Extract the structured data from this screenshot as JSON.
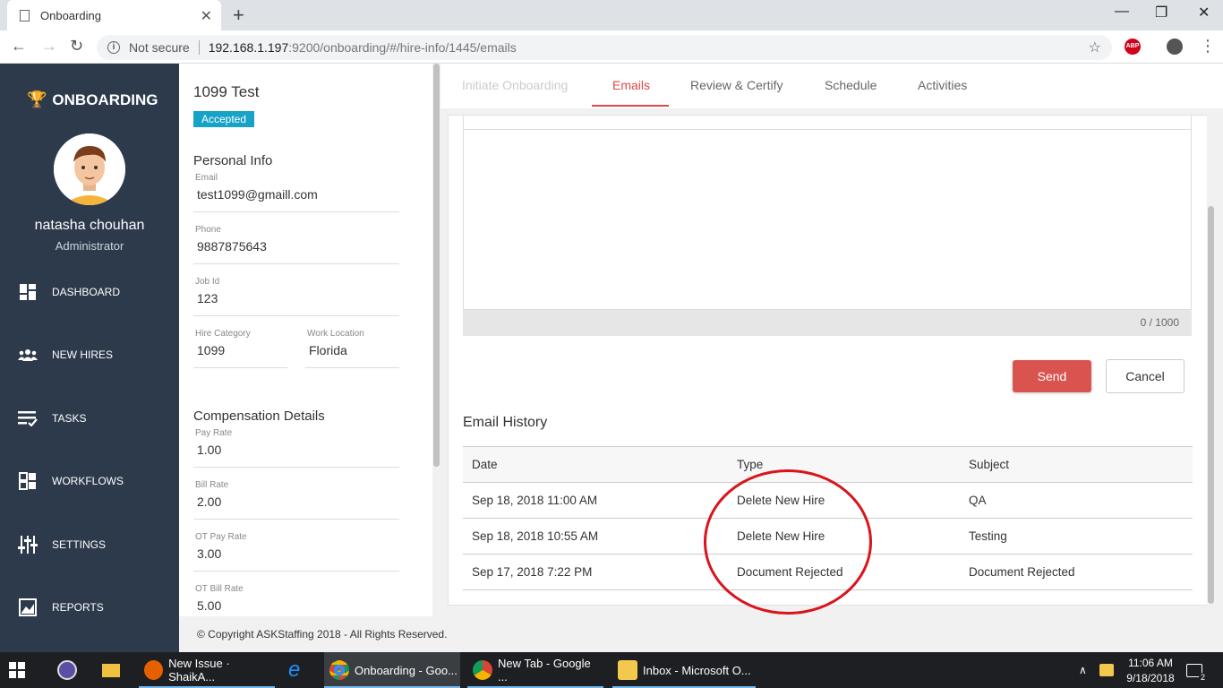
{
  "browser": {
    "tab_title": "Onboarding",
    "url_security": "Not secure",
    "url_host": "192.168.1.197",
    "url_path": ":9200/onboarding/#/hire-info/1445/emails",
    "abp_label": "ABP"
  },
  "sidebar": {
    "logo": "ONBOARDING",
    "user_name": "natasha chouhan",
    "user_role": "Administrator",
    "items": [
      {
        "label": "DASHBOARD",
        "icon": "dashboard-icon"
      },
      {
        "label": "NEW HIRES",
        "icon": "people-icon"
      },
      {
        "label": "TASKS",
        "icon": "tasks-icon"
      },
      {
        "label": "WORKFLOWS",
        "icon": "workflows-icon"
      },
      {
        "label": "SETTINGS",
        "icon": "sliders-icon"
      },
      {
        "label": "REPORTS",
        "icon": "reports-icon"
      }
    ]
  },
  "hire": {
    "name": "1099 Test",
    "status": "Accepted",
    "personal_title": "Personal Info",
    "email_label": "Email",
    "email": "test1099@gmaill.com",
    "phone_label": "Phone",
    "phone": "9887875643",
    "jobid_label": "Job Id",
    "jobid": "123",
    "category_label": "Hire Category",
    "category": "1099",
    "location_label": "Work Location",
    "location": "Florida",
    "comp_title": "Compensation Details",
    "payrate_label": "Pay Rate",
    "payrate": "1.00",
    "billrate_label": "Bill Rate",
    "billrate": "2.00",
    "otpay_label": "OT Pay Rate",
    "otpay": "3.00",
    "otbill_label": "OT Bill Rate",
    "otbill": "5.00"
  },
  "tabs": {
    "initiate": "Initiate Onboarding",
    "emails": "Emails",
    "review": "Review & Certify",
    "schedule": "Schedule",
    "activities": "Activities"
  },
  "email_form": {
    "counter": "0 / 1000",
    "send": "Send",
    "cancel": "Cancel"
  },
  "history": {
    "title": "Email History",
    "headers": [
      "Date",
      "Type",
      "Subject"
    ],
    "rows": [
      [
        "Sep 18, 2018 11:00 AM",
        "Delete New Hire",
        "QA"
      ],
      [
        "Sep 18, 2018 10:55 AM",
        "Delete New Hire",
        "Testing"
      ],
      [
        "Sep 17, 2018 7:22 PM",
        "Document Rejected",
        "Document Rejected"
      ]
    ]
  },
  "footer": "© Copyright ASKStaffing 2018 - All Rights Reserved.",
  "taskbar": {
    "items": [
      {
        "label": "New Issue · ShaikA..."
      },
      {
        "label": "Onboarding - Goo..."
      },
      {
        "label": "New Tab - Google ..."
      },
      {
        "label": "Inbox - Microsoft O..."
      }
    ],
    "time": "11:06 AM",
    "date": "9/18/2018",
    "notif_count": "2"
  },
  "colors": {
    "accent": "#dc4a4a",
    "sidebar_bg": "#2d3a4b",
    "badge": "#17a2c8"
  }
}
